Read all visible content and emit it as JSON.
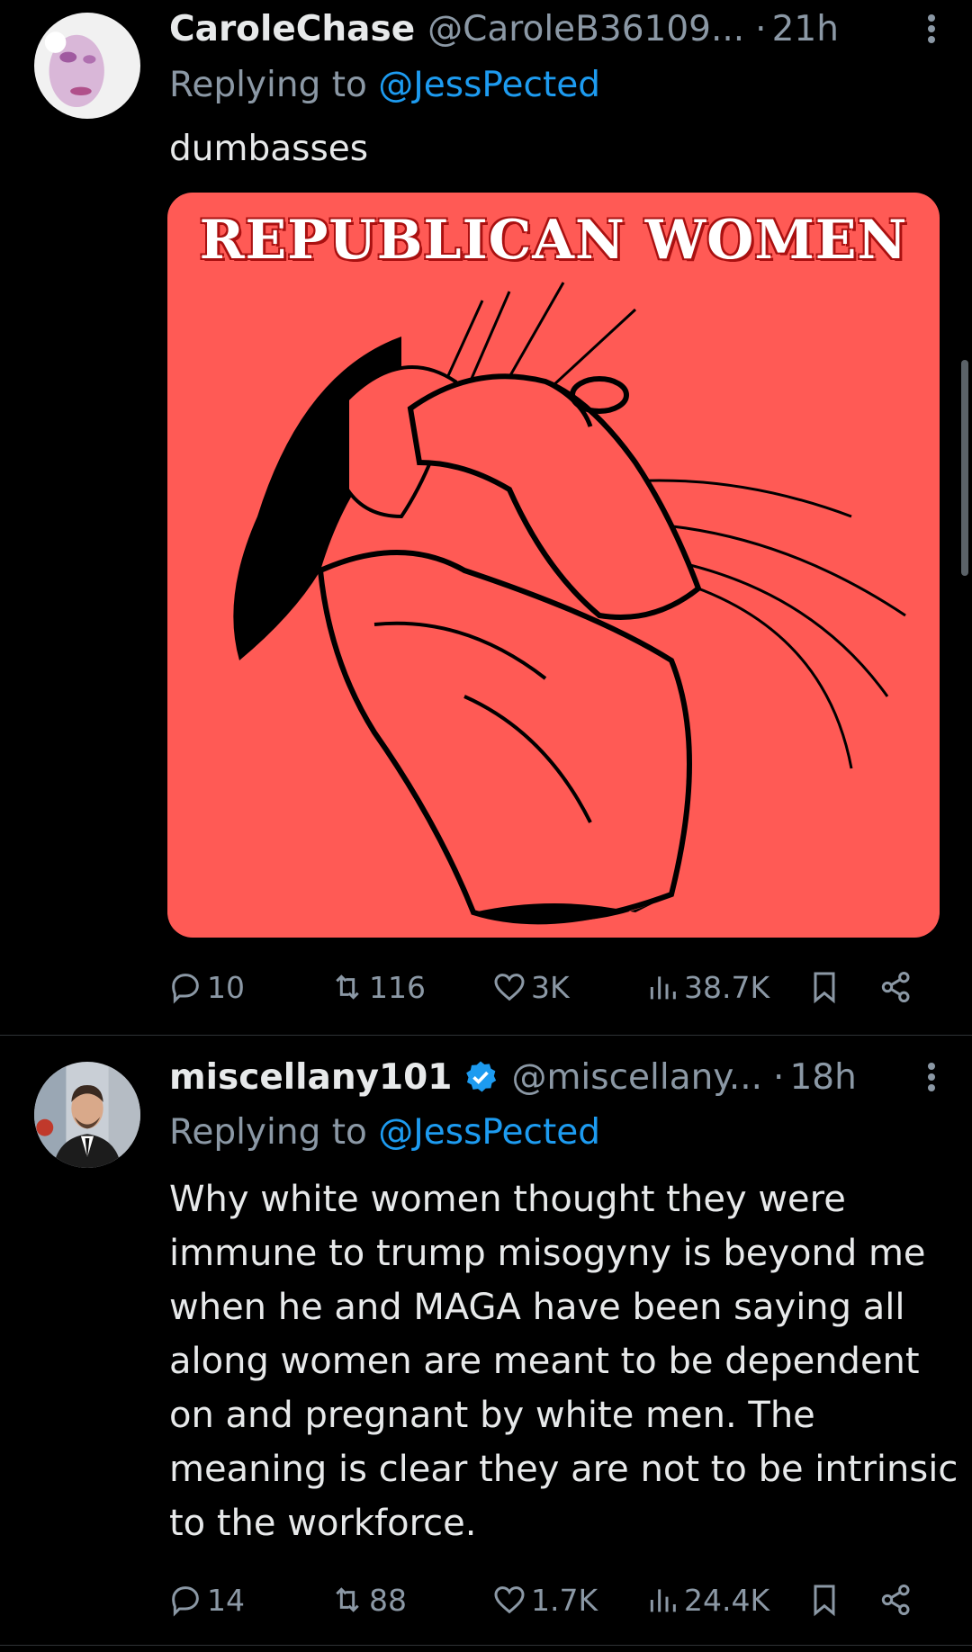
{
  "tweets": [
    {
      "name": "CaroleChase",
      "handle": "@CaroleB36109...",
      "dot": "·",
      "time": "21h",
      "replying_prefix": "Replying to ",
      "replying_to": "@JessPected",
      "text": "dumbasses",
      "media_text": "REPUBLICAN WOMEN",
      "verified": false,
      "stats": {
        "replies": "10",
        "reposts": "116",
        "likes": "3K",
        "views": "38.7K"
      }
    },
    {
      "name": "miscellany101",
      "handle": "@miscellany...",
      "dot": "·",
      "time": "18h",
      "replying_prefix": "Replying to ",
      "replying_to": "@JessPected",
      "text": "Why white women thought they were immune to trump misogyny is beyond me when he and MAGA have been saying all along women are meant to be dependent on and pregnant by white men. The meaning is clear they are not to be intrinsic to the workforce.",
      "verified": true,
      "stats": {
        "replies": "14",
        "reposts": "88",
        "likes": "1.7K",
        "views": "24.4K"
      }
    }
  ],
  "colors": {
    "background": "#000000",
    "text": "#e7e9ea",
    "muted": "#8b98a5",
    "link": "#1d9bf0",
    "media_bg": "#ff5a55"
  },
  "icons": [
    "more-icon",
    "verified-icon",
    "reply-icon",
    "repost-icon",
    "like-icon",
    "views-icon",
    "bookmark-icon",
    "share-icon"
  ]
}
